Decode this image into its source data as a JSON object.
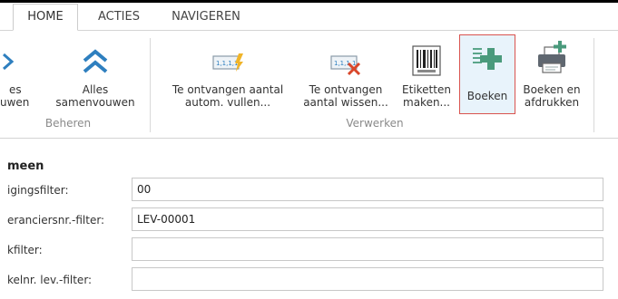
{
  "tabs": [
    {
      "label": "HOME",
      "active": true
    },
    {
      "label": "ACTIES",
      "active": false
    },
    {
      "label": "NAVIGEREN",
      "active": false
    }
  ],
  "ribbon": {
    "beheren": {
      "group_label": "Beheren",
      "expand_line1": "es",
      "expand_line2": "uwen",
      "collapse_line1": "Alles",
      "collapse_line2": "samenvouwen"
    },
    "verwerken": {
      "group_label": "Verwerken",
      "autofill_line1": "Te ontvangen aantal",
      "autofill_line2": "autom. vullen...",
      "clear_line1": "Te ontvangen",
      "clear_line2": "aantal wissen...",
      "labels_line1": "Etiketten",
      "labels_line2": "maken...",
      "post_label": "Boeken",
      "post_print_line1": "Boeken en",
      "post_print_line2": "afdrukken"
    }
  },
  "general": {
    "title": "meen",
    "fields": [
      {
        "label": "igingsfilter:",
        "value": "00"
      },
      {
        "label": "eranciersnr.-filter:",
        "value": "LEV-00001"
      },
      {
        "label": "kfilter:",
        "value": ""
      },
      {
        "label": "kelnr. lev.-filter:",
        "value": ""
      }
    ]
  },
  "colors": {
    "accent_blue": "#2e7fbf",
    "selected_border": "#d9534f",
    "selected_fill": "#e8f3fb",
    "icon_green": "#5aa58a",
    "icon_red": "#d9472b"
  }
}
